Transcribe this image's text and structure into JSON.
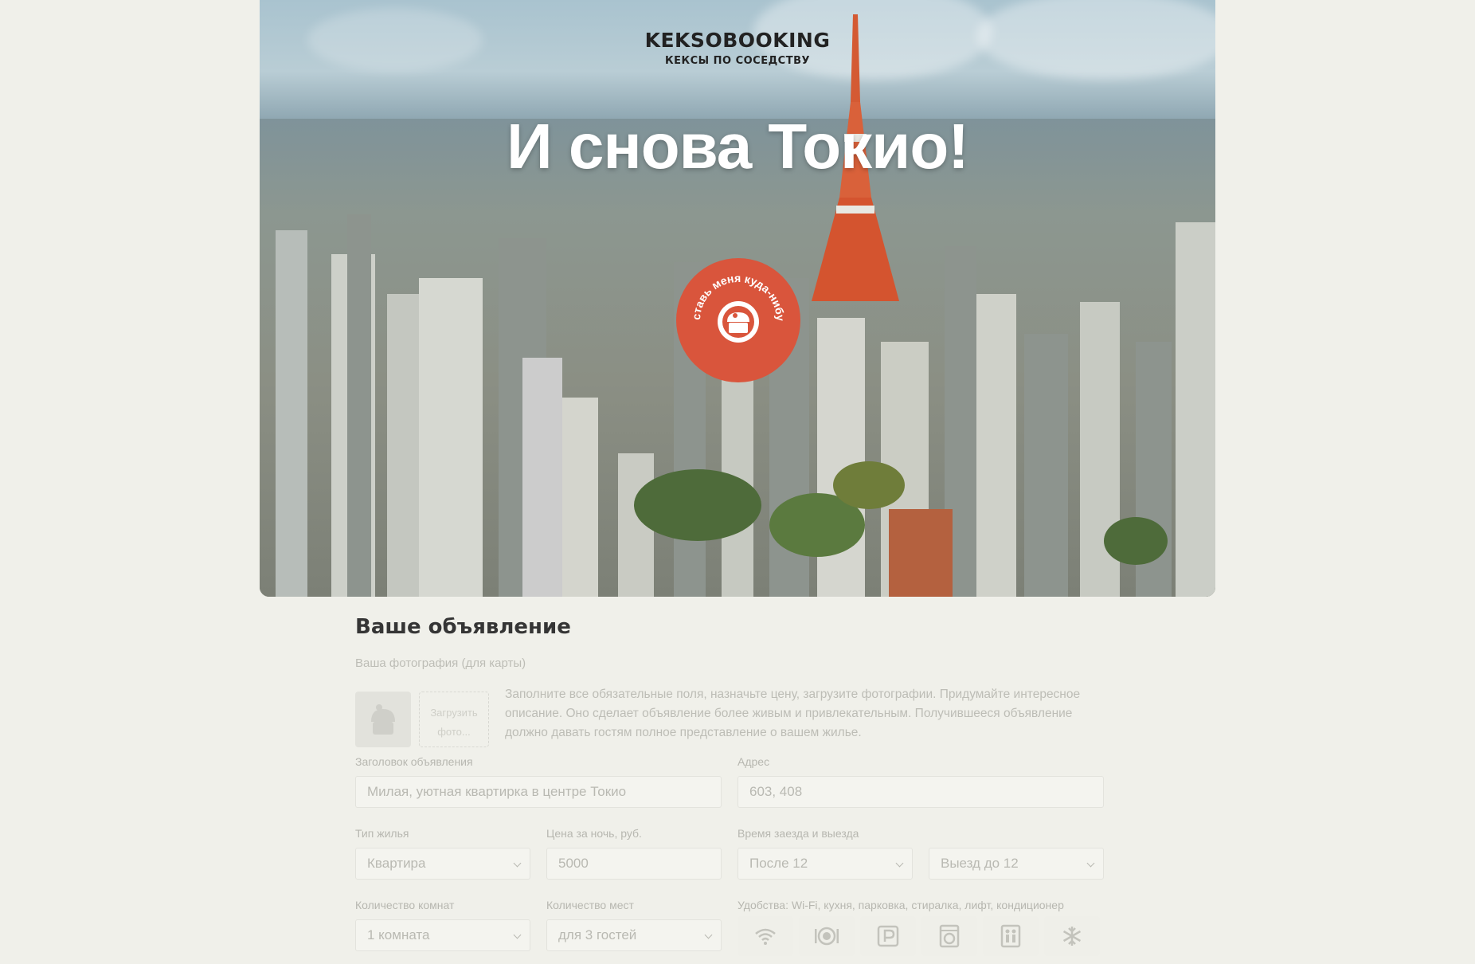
{
  "header": {
    "logo_name": "KEKSOBOOKING",
    "logo_tagline": "КЕКСЫ ПО СОСЕДСТВУ",
    "hero_title": "И снова Токио!",
    "pin_text": "Поставь меня куда-нибудь"
  },
  "form": {
    "title": "Ваше объявление",
    "photo_label": "Ваша фотография (для карты)",
    "upload_label": "Загрузить фото...",
    "hint": "Заполните все обязательные поля, назначьте цену, загрузите фотографии. Придумайте интересное описание. Оно сделает объявление более живым и привлекательным. Получившееся объявление должно давать гостям полное представление о вашем жилье.",
    "title_label": "Заголовок объявления",
    "title_placeholder": "Милая, уютная квартирка в центре Токио",
    "address_label": "Адрес",
    "address_value": "603, 408",
    "type_label": "Тип жилья",
    "type_value": "Квартира",
    "price_label": "Цена за ночь, руб.",
    "price_value": "5000",
    "time_label": "Время заезда и выезда",
    "checkin_value": "После 12",
    "checkout_value": "Выезд до 12",
    "rooms_label": "Количество комнат",
    "rooms_value": "1 комната",
    "capacity_label": "Количество мест",
    "capacity_value": "для 3 гостей",
    "features_label": "Удобства: Wi-Fi, кухня, парковка, стиралка, лифт, кондиционер",
    "features": [
      "wifi-icon",
      "dishwasher-icon",
      "parking-icon",
      "washer-icon",
      "elevator-icon",
      "conditioner-icon"
    ]
  },
  "colors": {
    "background": "#f0f0ea",
    "pin": "#d9553c",
    "text": "#353535",
    "muted": "#b9b9b2"
  }
}
